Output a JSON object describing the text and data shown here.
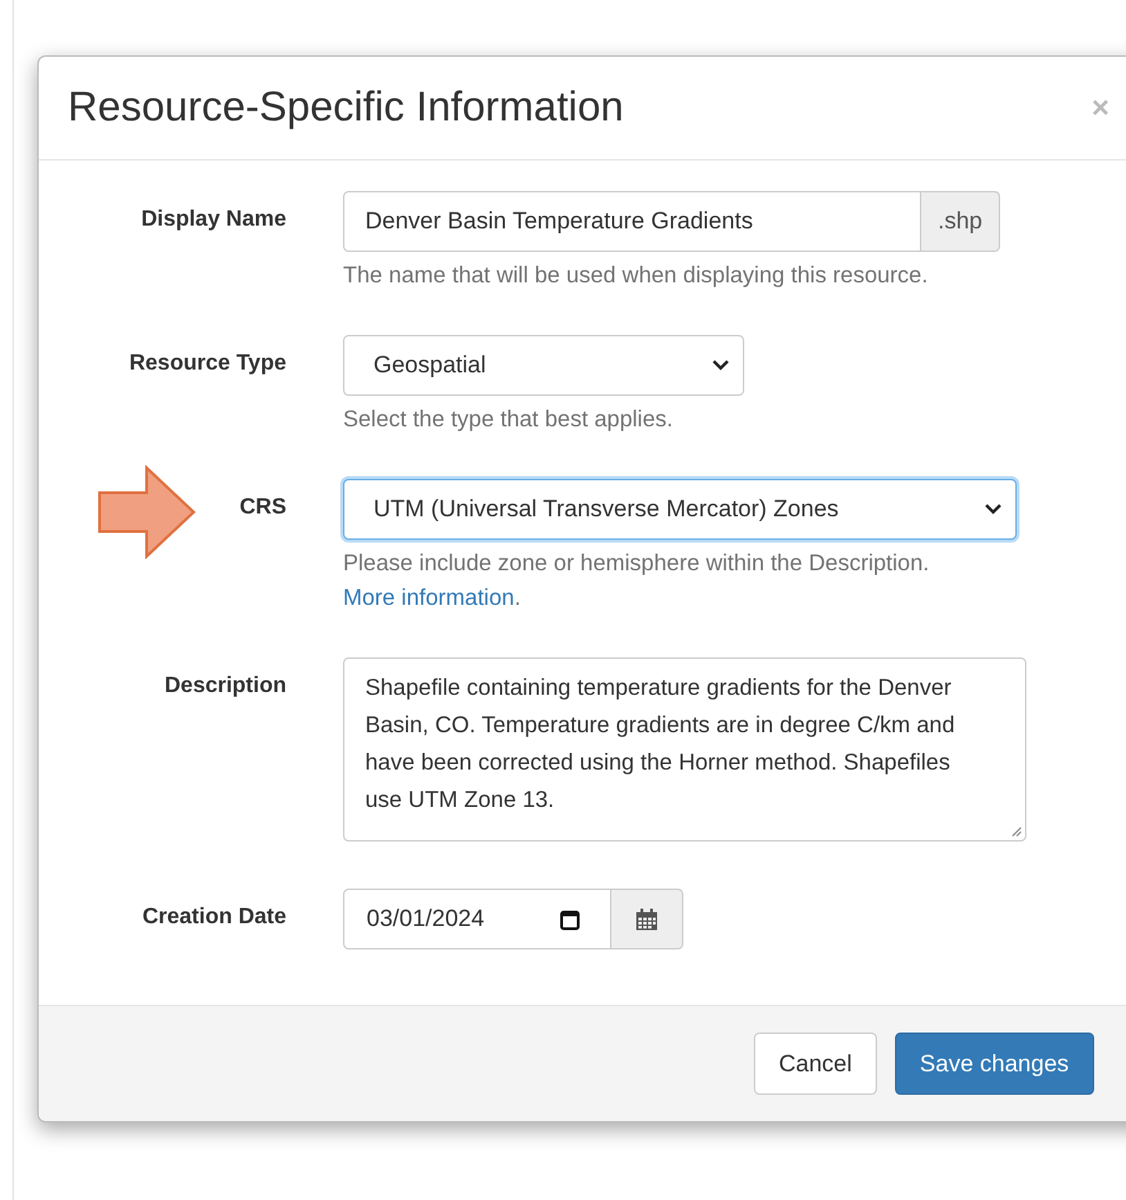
{
  "dialog": {
    "title": "Resource-Specific Information",
    "close": "×"
  },
  "fields": [
    {
      "kind": "text",
      "label": "Display Name",
      "value": "Denver Basin Temperature Gradients",
      "addon": ".shp",
      "help": "The name that will be used when displaying this resource.",
      "focused": false,
      "marked": false
    },
    {
      "kind": "select",
      "label": "Resource Type",
      "value": "Geospatial",
      "help": "Select the type that best applies.",
      "focused": false,
      "marked": false
    },
    {
      "kind": "select",
      "label": "CRS",
      "value": "UTM (Universal Transverse Mercator) Zones",
      "help": "Please include zone or hemisphere within the Description.",
      "link": "More information",
      "link_after": ".",
      "focused": true,
      "marked": true
    },
    {
      "kind": "textarea",
      "label": "Description",
      "value": "Shapefile containing temperature gradients for the Denver Basin, CO. Temperature gradients are in degree C/km and have been corrected using the Horner method. Shapefiles use UTM Zone 13.",
      "focused": false,
      "marked": false
    },
    {
      "kind": "date",
      "label": "Creation Date",
      "value": "03/01/2024",
      "focused": false,
      "marked": false
    }
  ],
  "buttons": [
    {
      "label": "Cancel",
      "kind": "default"
    },
    {
      "label": "Save changes",
      "kind": "primary"
    }
  ]
}
